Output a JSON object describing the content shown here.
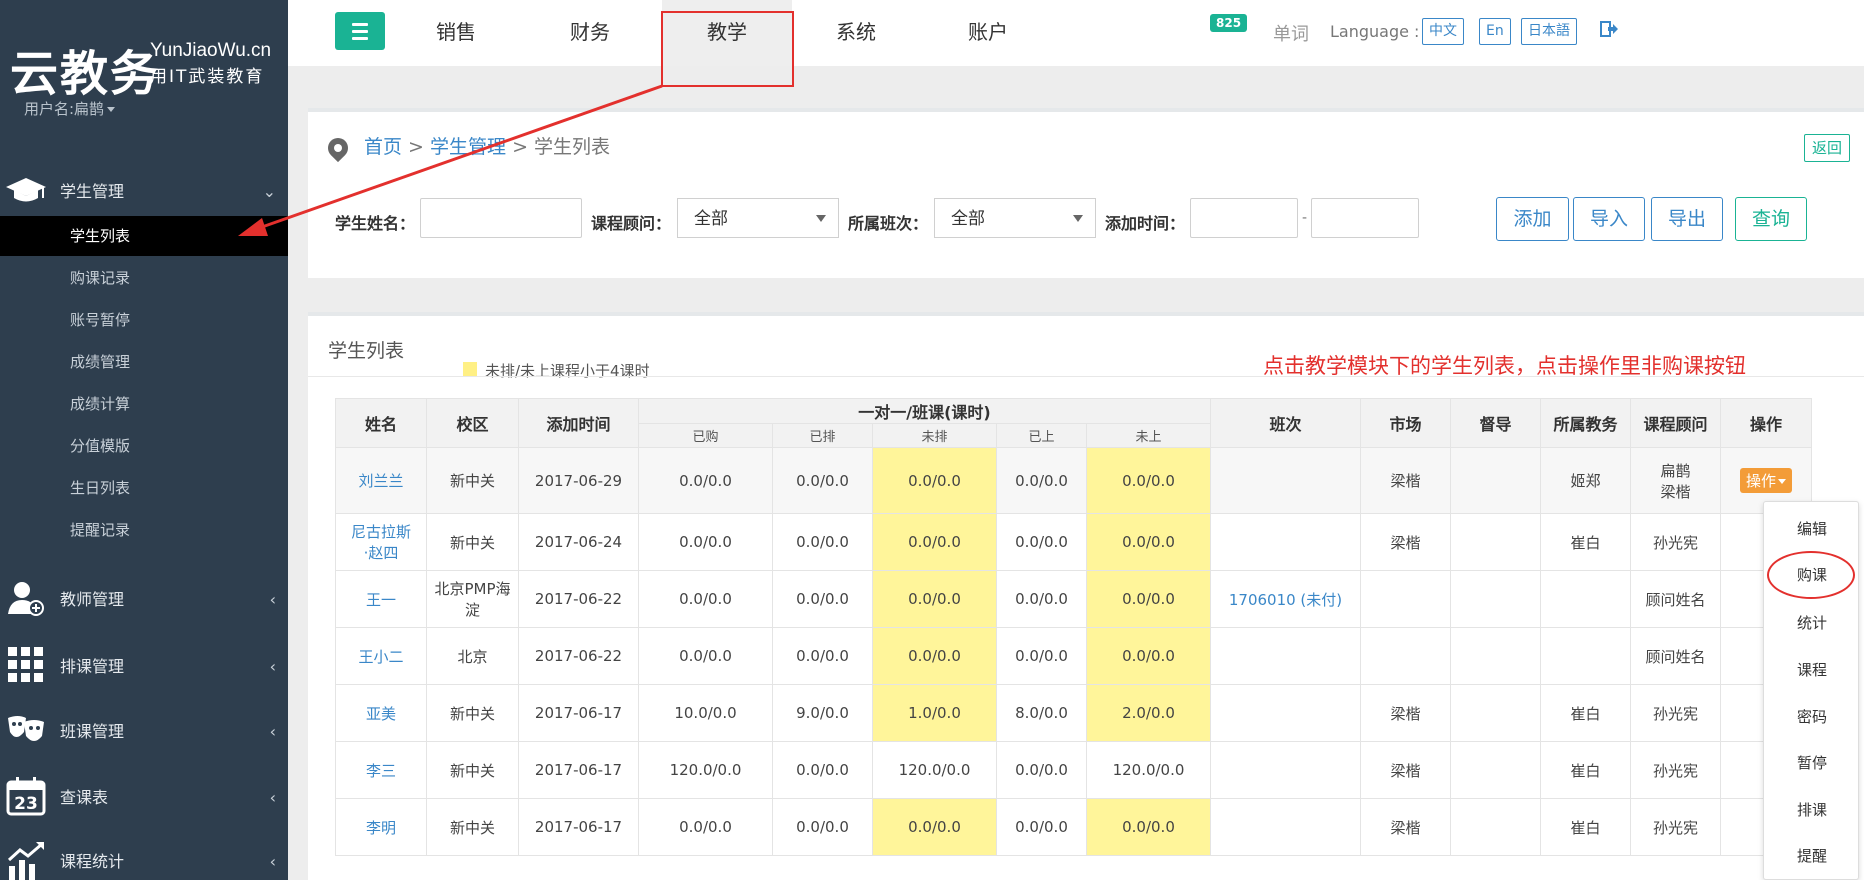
{
  "sidebar": {
    "logo_cn": "云教务",
    "logo_en": "YunJiaoWu.cn",
    "slogan": "用IT武装教育",
    "username": "用户名:扁鹊",
    "group_student": "学生管理",
    "student_items": [
      "学生列表",
      "购课记录",
      "账号暂停",
      "成绩管理",
      "成绩计算",
      "分值模版",
      "生日列表",
      "提醒记录"
    ],
    "group_teacher": "教师管理",
    "group_schedule": "排课管理",
    "group_class": "班课管理",
    "group_timetable": "查课表",
    "group_stats": "课程统计",
    "calendar_day": "23"
  },
  "topnav": {
    "items": [
      "销售",
      "财务",
      "教学",
      "系统",
      "账户"
    ],
    "badge": "825",
    "word": "单词",
    "language_label": "Language :",
    "languages": [
      "中文",
      "En",
      "日本語"
    ]
  },
  "breadcrumb": {
    "home": "首页",
    "sep": " > ",
    "section": "学生管理",
    "page": "学生列表",
    "back": "返回"
  },
  "filters": {
    "student_name": "学生姓名：",
    "advisor": "课程顾问：",
    "advisor_value": "全部",
    "class": "所属班次：",
    "class_value": "全部",
    "added_time": "添加时间：",
    "dash": "-",
    "buttons": [
      "添加",
      "导入",
      "导出",
      "查询"
    ]
  },
  "list": {
    "title": "学生列表",
    "legend": "未排/未上课程小于4课时",
    "annotation": "点击教学模块下的学生列表，点击操作里非购课按钮"
  },
  "table": {
    "headers": {
      "name": "姓名",
      "campus": "校区",
      "added": "添加时间",
      "group": "一对一/班课(课时)",
      "bought": "已购",
      "scheduled": "已排",
      "unscheduled": "未排",
      "attended": "已上",
      "unattended": "未上",
      "class": "班次",
      "market": "市场",
      "supervisor": "督导",
      "teaching": "所属教务",
      "advisor": "课程顾问",
      "op": "操作"
    },
    "rows": [
      {
        "name": "刘兰兰",
        "campus": "新中关",
        "added": "2017-06-29",
        "bought": "0.0/0.0",
        "scheduled": "0.0/0.0",
        "unscheduled": "0.0/0.0",
        "attended": "0.0/0.0",
        "unattended": "0.0/0.0",
        "class": "",
        "market": "梁楷",
        "supervisor": "",
        "teaching": "姬郑",
        "advisor1": "扁鹊",
        "advisor2": "梁楷"
      },
      {
        "name": "尼古拉斯",
        "name2": "·赵四",
        "campus": "新中关",
        "added": "2017-06-24",
        "bought": "0.0/0.0",
        "scheduled": "0.0/0.0",
        "unscheduled": "0.0/0.0",
        "attended": "0.0/0.0",
        "unattended": "0.0/0.0",
        "class": "",
        "market": "梁楷",
        "supervisor": "",
        "teaching": "崔白",
        "advisor": "孙光宪"
      },
      {
        "name": "王一",
        "campus": "北京PMP海淀",
        "added": "2017-06-22",
        "bought": "0.0/0.0",
        "scheduled": "0.0/0.0",
        "unscheduled": "0.0/0.0",
        "attended": "0.0/0.0",
        "unattended": "0.0/0.0",
        "class": "1706010 (未付)",
        "market": "",
        "supervisor": "",
        "teaching": "",
        "advisor": "顾问姓名"
      },
      {
        "name": "王小二",
        "campus": "北京",
        "added": "2017-06-22",
        "bought": "0.0/0.0",
        "scheduled": "0.0/0.0",
        "unscheduled": "0.0/0.0",
        "attended": "0.0/0.0",
        "unattended": "0.0/0.0",
        "class": "",
        "market": "",
        "supervisor": "",
        "teaching": "",
        "advisor": "顾问姓名"
      },
      {
        "name": "亚美",
        "campus": "新中关",
        "added": "2017-06-17",
        "bought": "10.0/0.0",
        "scheduled": "9.0/0.0",
        "unscheduled": "1.0/0.0",
        "attended": "8.0/0.0",
        "unattended": "2.0/0.0",
        "class": "",
        "market": "梁楷",
        "supervisor": "",
        "teaching": "崔白",
        "advisor": "孙光宪"
      },
      {
        "name": "李三",
        "campus": "新中关",
        "added": "2017-06-17",
        "bought": "120.0/0.0",
        "scheduled": "0.0/0.0",
        "unscheduled": "120.0/0.0",
        "attended": "0.0/0.0",
        "unattended": "120.0/0.0",
        "class": "",
        "market": "梁楷",
        "supervisor": "",
        "teaching": "崔白",
        "advisor": "孙光宪"
      },
      {
        "name": "李明",
        "campus": "新中关",
        "added": "2017-06-17",
        "bought": "0.0/0.0",
        "scheduled": "0.0/0.0",
        "unscheduled": "0.0/0.0",
        "attended": "0.0/0.0",
        "unattended": "0.0/0.0",
        "class": "",
        "market": "梁楷",
        "supervisor": "",
        "teaching": "崔白",
        "advisor": "孙光宪"
      }
    ],
    "op_label": "操作"
  },
  "op_menu": [
    "编辑",
    "购课",
    "统计",
    "课程",
    "密码",
    "暂停",
    "排课",
    "提醒"
  ],
  "colors": {
    "accent": "#1ab394",
    "link": "#3a87c8",
    "highlight": "#fff59a",
    "annotation": "#e3302d",
    "op": "#f39c38",
    "sidebar": "#2e3e4e"
  }
}
